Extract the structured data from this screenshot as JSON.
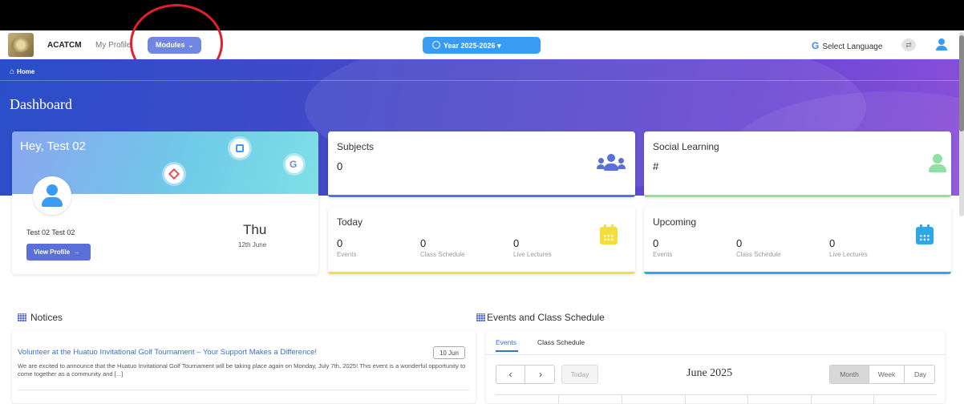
{
  "topnav": {
    "brand": "ACATCM",
    "my_profile": "My Profile",
    "modules": "Modules",
    "year": "Year 2025-2026",
    "select_language": "Select Language",
    "g_letter": "G"
  },
  "breadcrumb": {
    "home": "Home"
  },
  "page": {
    "title": "Dashboard"
  },
  "welcome": {
    "greeting": "Hey, Test 02",
    "user_name": "Test 02 Test 02",
    "view_profile": "View Profile",
    "arrow": "→",
    "day_name": "Thu",
    "day_date": "12th June"
  },
  "subjects": {
    "title": "Subjects",
    "value": "0",
    "color": "#5a6fd8"
  },
  "social": {
    "title": "Social Learning",
    "value": "#",
    "color": "#8ee0a4"
  },
  "today": {
    "title": "Today",
    "color": "#f3de3a",
    "items": [
      {
        "value": "0",
        "label": "Events"
      },
      {
        "value": "0",
        "label": "Class Schedule"
      },
      {
        "value": "0",
        "label": "Live Lectures"
      }
    ]
  },
  "upcoming": {
    "title": "Upcoming",
    "color": "#2fa6e6",
    "items": [
      {
        "value": "0",
        "label": "Events"
      },
      {
        "value": "0",
        "label": "Class Schedule"
      },
      {
        "value": "0",
        "label": "Live Lectures"
      }
    ]
  },
  "notices": {
    "heading": "Notices",
    "items": [
      {
        "title": "Volunteer at the Huatuo Invitational Golf Tournament – Your Support Makes a Difference!",
        "date": "10 Jun",
        "body": "We are excited to announce that the Huatuo Invitational Golf Tournament will be taking place again on Monday, July 7th, 2025! This event is a wonderful opportunity to come together as a community and [...]"
      }
    ]
  },
  "events": {
    "heading": "Events and Class Schedule",
    "tabs": [
      "Events",
      "Class Schedule"
    ],
    "prev": "‹",
    "next": "›",
    "today_btn": "Today",
    "month_title": "June 2025",
    "views": [
      "Month",
      "Week",
      "Day"
    ]
  },
  "colors": {
    "banner_start": "#2a4ec9",
    "banner_end": "#8a4fd9",
    "annotation_circle": "#e0202a"
  }
}
